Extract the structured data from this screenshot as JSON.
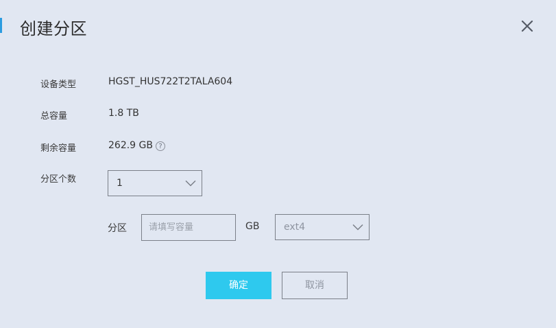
{
  "dialog": {
    "title": "创建分区"
  },
  "form": {
    "device_type": {
      "label": "设备类型",
      "value": "HGST_HUS722T2TALA604"
    },
    "total_capacity": {
      "label": "总容量",
      "value": "1.8 TB"
    },
    "free_capacity": {
      "label": "剩余容量",
      "value": "262.9 GB",
      "help_glyph": "?"
    },
    "partition_count": {
      "label": "分区个数",
      "selected": "1"
    },
    "partition": {
      "label": "分区",
      "size_placeholder": "请填写容量",
      "unit": "GB",
      "fs_selected": "ext4"
    }
  },
  "buttons": {
    "confirm": "确定",
    "cancel": "取消"
  },
  "colors": {
    "background": "#e1e7f2",
    "accent": "#2c9ce0",
    "primary_button": "#2ec9ee"
  },
  "icons": {
    "close": "close-icon",
    "help": "help-circle-icon",
    "dropdown": "chevron-down-icon"
  }
}
